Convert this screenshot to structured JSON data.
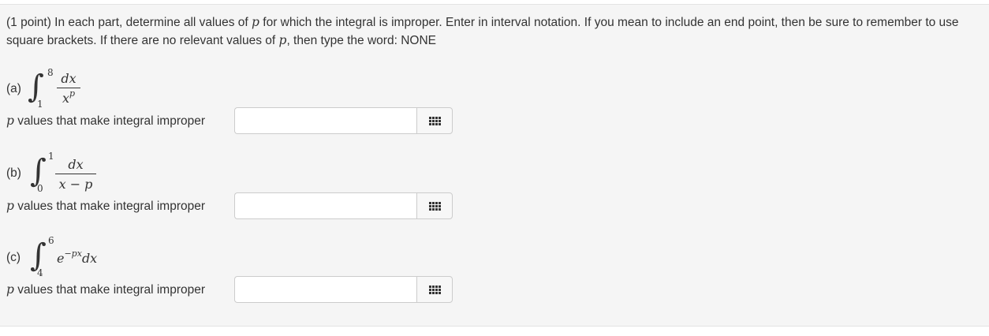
{
  "intro": {
    "t1": "(1 point) In each part, determine all values of ",
    "p1": "p",
    "t2": " for which the integral is improper. Enter in interval notation. If you mean to include an end point, then be sure to remember to use square brackets. If there are no relevant values of ",
    "p2": "p",
    "t3": ", then type the word: NONE"
  },
  "parts": [
    {
      "label": "(a)",
      "upper": "8",
      "lower": "1",
      "numerator": "dx",
      "denominator_base": "x",
      "denominator_exp": "p",
      "answer_var": "p",
      "answer_text": " values that make integral improper",
      "input_value": ""
    },
    {
      "label": "(b)",
      "upper": "1",
      "lower": "0",
      "numerator": "dx",
      "denominator": "x − p",
      "answer_var": "p",
      "answer_text": " values that make integral improper",
      "input_value": ""
    },
    {
      "label": "(c)",
      "upper": "6",
      "lower": "4",
      "integrand_base": "e",
      "integrand_exp": "−px",
      "integrand_dx": "dx",
      "answer_var": "p",
      "answer_text": " values that make integral improper",
      "input_value": ""
    }
  ],
  "icons": {
    "palette": "grid-icon"
  }
}
